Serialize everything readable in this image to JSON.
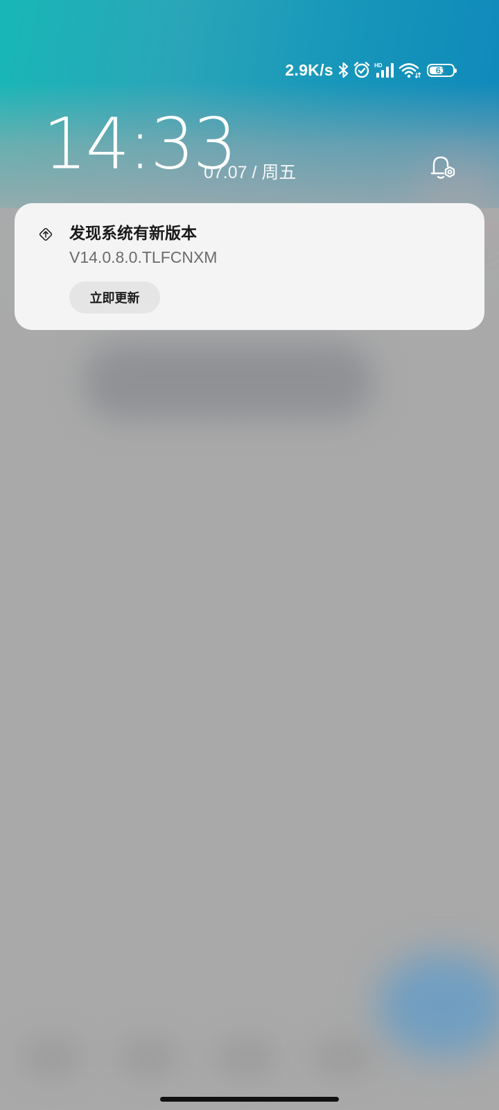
{
  "status_bar": {
    "net_speed": "2.9K/s",
    "battery_level": "61",
    "battery_fraction": 0.61,
    "icons": [
      "bluetooth-icon",
      "alarm-icon",
      "hd-signal-icon",
      "wifi-icon",
      "battery-icon"
    ],
    "hd_label": "HD"
  },
  "lockscreen": {
    "time": "14:33",
    "date": "07.07 / 周五",
    "shortcut_icon": "bell-settings-icon"
  },
  "notification": {
    "icon": "system-update-icon",
    "title": "发现系统有新版本",
    "body": "V14.0.8.0.TLFCNXM",
    "action_label": "立即更新"
  },
  "colors": {
    "sky_teal": "#18b7b7",
    "sky_blue": "#0f88bb",
    "card_bg": "#f4f4f4",
    "button_bg": "#e5e5e5",
    "wallpaper_gray": "#a9a9a9"
  }
}
